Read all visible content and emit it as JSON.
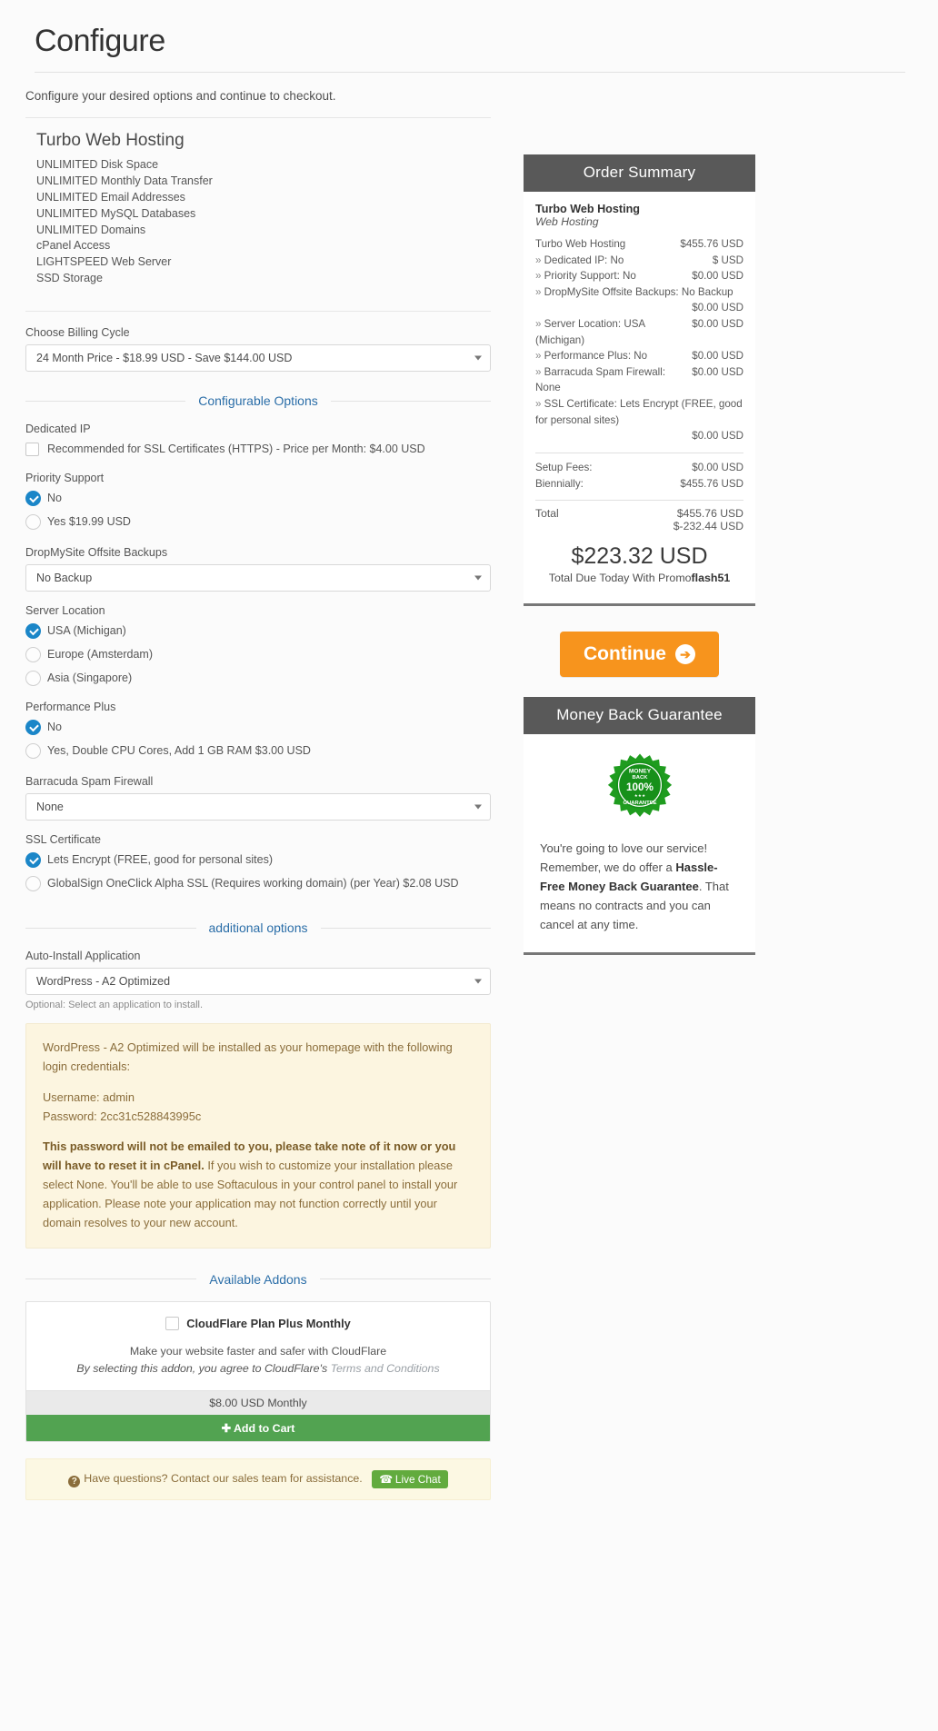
{
  "header": {
    "title": "Configure",
    "intro": "Configure your desired options and continue to checkout."
  },
  "product": {
    "name": "Turbo Web Hosting",
    "features": [
      "UNLIMITED Disk Space",
      "UNLIMITED Monthly Data Transfer",
      "UNLIMITED Email Addresses",
      "UNLIMITED MySQL Databases",
      "UNLIMITED Domains",
      "cPanel Access",
      "LIGHTSPEED Web Server",
      "SSD Storage"
    ]
  },
  "billing": {
    "label": "Choose Billing Cycle",
    "selected": "24 Month Price - $18.99 USD - Save $144.00 USD"
  },
  "dividers": {
    "configurable": "Configurable Options",
    "additional": "additional options",
    "addons": "Available Addons"
  },
  "options": {
    "dedicated_ip": {
      "label": "Dedicated IP",
      "checkbox_label": "Recommended for SSL Certificates (HTTPS) - Price per Month: $4.00 USD",
      "checked": false
    },
    "priority_support": {
      "label": "Priority Support",
      "choices": [
        {
          "label": "No",
          "selected": true
        },
        {
          "label": "Yes $19.99 USD",
          "selected": false
        }
      ]
    },
    "dropmysite": {
      "label": "DropMySite Offsite Backups",
      "selected": "No Backup"
    },
    "server_location": {
      "label": "Server Location",
      "choices": [
        {
          "label": "USA (Michigan)",
          "selected": true
        },
        {
          "label": "Europe (Amsterdam)",
          "selected": false
        },
        {
          "label": "Asia (Singapore)",
          "selected": false
        }
      ]
    },
    "performance_plus": {
      "label": "Performance Plus",
      "choices": [
        {
          "label": "No",
          "selected": true
        },
        {
          "label": "Yes, Double CPU Cores, Add 1 GB RAM $3.00 USD",
          "selected": false
        }
      ]
    },
    "barracuda": {
      "label": "Barracuda Spam Firewall",
      "selected": "None"
    },
    "ssl": {
      "label": "SSL Certificate",
      "choices": [
        {
          "label": "Lets Encrypt (FREE, good for personal sites)",
          "selected": true
        },
        {
          "label": "GlobalSign OneClick Alpha SSL (Requires working domain) (per Year) $2.08 USD",
          "selected": false
        }
      ]
    }
  },
  "autoinstall": {
    "label": "Auto-Install Application",
    "selected": "WordPress - A2 Optimized",
    "help": "Optional: Select an application to install."
  },
  "notice": {
    "line1": "WordPress - A2 Optimized will be installed as your homepage with the following login credentials:",
    "username": "Username: admin",
    "password": "Password: 2cc31c528843995c",
    "warning_bold": "This password will not be emailed to you, please take note of it now or you will have to reset it in cPanel.",
    "warning_rest": " If you wish to customize your installation please select None. You'll be able to use Softaculous in your control panel to install your application. Please note your application may not function correctly until your domain resolves to your new account."
  },
  "addon": {
    "title": "CloudFlare Plan Plus Monthly",
    "checked": false,
    "desc_line1": "Make your website faster and safer with CloudFlare",
    "desc_line2_prefix": "By selecting this addon, you agree to CloudFlare's ",
    "desc_line2_link": "Terms and Conditions",
    "price": "$8.00 USD Monthly",
    "cart_button": "Add to Cart"
  },
  "questions": {
    "text": "Have questions? Contact our sales team for assistance.",
    "live_chat": "Live Chat"
  },
  "order_summary": {
    "heading": "Order Summary",
    "product_name": "Turbo Web Hosting",
    "category": "Web Hosting",
    "lines": [
      {
        "label": "Turbo Web Hosting",
        "price": "$455.76 USD",
        "sub": false
      },
      {
        "label": "Dedicated IP: No",
        "price": "$ USD",
        "sub": true
      },
      {
        "label": "Priority Support: No",
        "price": "$0.00 USD",
        "sub": true
      },
      {
        "label": "DropMySite Offsite Backups: No Backup",
        "price": "$0.00 USD",
        "sub": true,
        "wrap": true
      },
      {
        "label": "Server Location: USA (Michigan)",
        "price": "$0.00 USD",
        "sub": true
      },
      {
        "label": "Performance Plus: No",
        "price": "$0.00 USD",
        "sub": true
      },
      {
        "label": "Barracuda Spam Firewall: None",
        "price": "$0.00 USD",
        "sub": true
      },
      {
        "label": "SSL Certificate: Lets Encrypt (FREE, good for personal sites)",
        "price": "$0.00 USD",
        "sub": true,
        "wrap": true
      }
    ],
    "setup_fees_label": "Setup Fees:",
    "setup_fees_value": "$0.00 USD",
    "recurring_label": "Biennially:",
    "recurring_value": "$455.76 USD",
    "total_label": "Total",
    "total_value": "$455.76 USD",
    "credit_value": "$-232.44 USD",
    "due_amount": "$223.32 USD",
    "due_label_prefix": "Total Due Today With Promo",
    "due_label_promo": "flash51"
  },
  "continue": {
    "label": "Continue"
  },
  "money_back": {
    "heading": "Money Back Guarantee",
    "badge_top": "MONEY BACK",
    "badge_percent": "100%",
    "badge_bottom": "GUARANTEE",
    "text_a": "You're going to love our service! Remember, we do offer a ",
    "text_b": "Hassle-Free Money Back Guarantee",
    "text_c": ". That means no contracts and you can cancel at any time."
  },
  "colors": {
    "accent_blue": "#2b6ea8",
    "radio_on": "#1b86c8",
    "orange": "#f7941d",
    "green": "#52a351",
    "panel_head": "#595959"
  }
}
